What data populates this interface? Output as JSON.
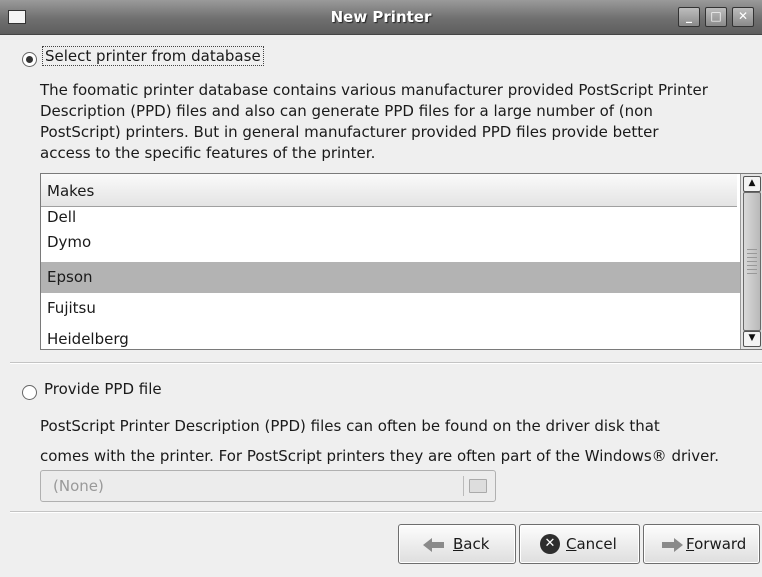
{
  "window": {
    "title": "New Printer",
    "minimize": "_",
    "maximize": "□",
    "close": "✕"
  },
  "database_option": {
    "label": "Select printer from database",
    "selected": true,
    "description_lines": [
      "The foomatic printer database contains various manufacturer provided PostScript Printer",
      "Description (PPD) files and also can generate PPD files for a large number of (non",
      "PostScript) printers. But in general manufacturer provided PPD files provide better",
      "access to the specific features of the printer."
    ]
  },
  "makes_list": {
    "header": "Makes",
    "items": [
      "Dell",
      "Dymo",
      "Epson",
      "Fujitsu",
      "Heidelberg"
    ],
    "selected": "Epson"
  },
  "ppd_option": {
    "label": "Provide PPD file",
    "selected": false,
    "description_lines": [
      "PostScript Printer Description (PPD) files can often be found on the driver disk that",
      "comes with the printer. For PostScript printers they are often part of the Windows® driver."
    ],
    "file_chooser_value": "(None)"
  },
  "buttons": {
    "back": {
      "mnemonic": "B",
      "rest": "ack"
    },
    "cancel": {
      "mnemonic": "C",
      "rest": "ancel"
    },
    "forward": {
      "mnemonic": "F",
      "rest": "orward"
    }
  }
}
